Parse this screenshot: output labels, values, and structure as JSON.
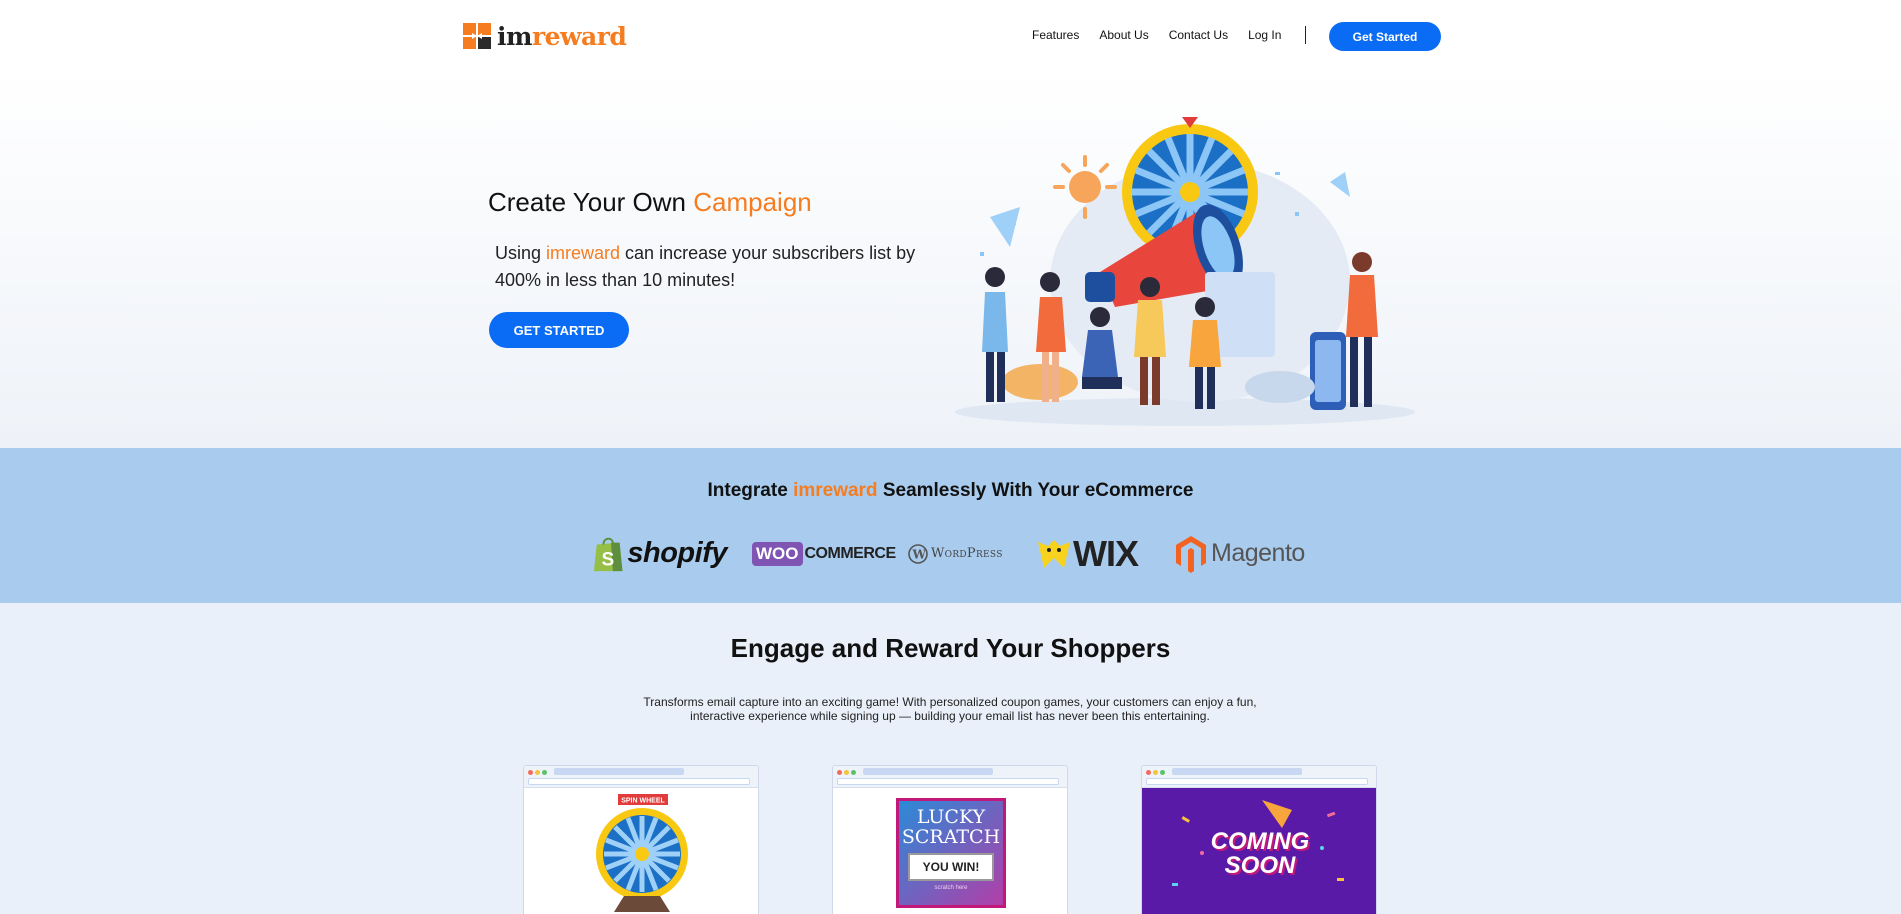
{
  "header": {
    "logo": {
      "part1": "im",
      "part2": "reward"
    },
    "nav": [
      {
        "label": "Features"
      },
      {
        "label": "About Us"
      },
      {
        "label": "Contact Us"
      },
      {
        "label": "Log In"
      }
    ],
    "cta_label": "Get Started"
  },
  "hero": {
    "title_part1": "Create Your Own ",
    "title_accent": "Campaign",
    "subtitle_part1": "Using ",
    "subtitle_accent": "imreward",
    "subtitle_part2": " can increase your subscribers list by 400% in less than 10 minutes!",
    "cta_label": "GET STARTED"
  },
  "integrations": {
    "title_part1": "Integrate ",
    "title_accent": "imreward",
    "title_part2": " Seamlessly With Your eCommerce",
    "brands": [
      {
        "name": "shopify",
        "color": "#95bf47"
      },
      {
        "name_part1": "WOO",
        "name_part2": "COMMERCE",
        "color": "#7f54b3"
      },
      {
        "name": "WordPress",
        "color": "#464646"
      },
      {
        "name": "WIX",
        "color": "#222222"
      },
      {
        "name": "Magento",
        "color": "#f26322"
      }
    ]
  },
  "engage": {
    "title": "Engage and Reward Your Shoppers",
    "description": "Transforms email capture into an exciting game! With personalized coupon games, your customers can enjoy a fun, interactive experience while signing up — building your email list has never been this entertaining.",
    "cards": [
      {
        "banner": "SPIN WHEEL"
      },
      {
        "line1": "LUCKY",
        "line2": "SCRATCH",
        "win": "YOU WIN!",
        "footer": "scratch here"
      },
      {
        "line1": "COMING",
        "line2": "SOON"
      }
    ]
  },
  "colors": {
    "accent": "#f57c1f",
    "primary": "#0a6cf5",
    "band": "#a9ccee"
  }
}
